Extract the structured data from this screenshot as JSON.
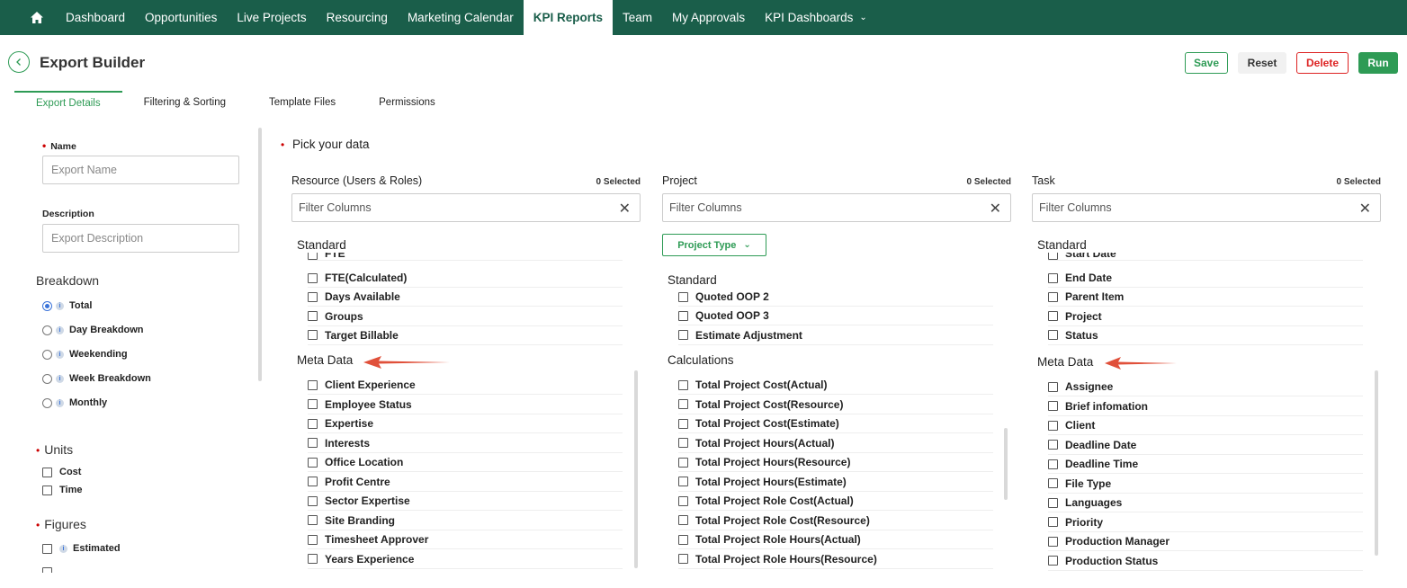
{
  "nav": {
    "items": [
      "Dashboard",
      "Opportunities",
      "Live Projects",
      "Resourcing",
      "Marketing Calendar",
      "KPI Reports",
      "Team",
      "My Approvals",
      "KPI Dashboards"
    ],
    "active": "KPI Reports",
    "chevron": "⌄"
  },
  "header": {
    "title": "Export Builder",
    "buttons": {
      "save": "Save",
      "reset": "Reset",
      "delete": "Delete",
      "run": "Run"
    }
  },
  "tabs": [
    "Export Details",
    "Filtering & Sorting",
    "Template Files",
    "Permissions"
  ],
  "active_tab": "Export Details",
  "left": {
    "name_label": "Name",
    "name_placeholder": "Export Name",
    "desc_label": "Description",
    "desc_placeholder": "Export Description",
    "breakdown_title": "Breakdown",
    "breakdown": [
      {
        "label": "Total",
        "selected": true
      },
      {
        "label": "Day Breakdown",
        "selected": false
      },
      {
        "label": "Weekending",
        "selected": false
      },
      {
        "label": "Week Breakdown",
        "selected": false
      },
      {
        "label": "Monthly",
        "selected": false
      }
    ],
    "units_title": "Units",
    "units": [
      "Cost",
      "Time"
    ],
    "figures_title": "Figures",
    "figures": [
      "Estimated"
    ],
    "info_glyph": "i"
  },
  "main": {
    "pick_title": "Pick your data",
    "columns": [
      {
        "title": "Resource (Users & Roles)",
        "count": "0 Selected",
        "filter_placeholder": "Filter Columns",
        "standard_label": "Standard",
        "standard_partial": "FTE",
        "standard_items": [
          "FTE(Calculated)",
          "Days Available",
          "Groups",
          "Target Billable"
        ],
        "second_label": "Meta Data",
        "second_items": [
          "Client Experience",
          "Employee Status",
          "Expertise",
          "Interests",
          "Office Location",
          "Profit Centre",
          "Sector Expertise",
          "Site Branding",
          "Timesheet Approver",
          "Years Experience"
        ]
      },
      {
        "title": "Project",
        "count": "0 Selected",
        "filter_placeholder": "Filter Columns",
        "type_button": "Project Type",
        "standard_label": "Standard",
        "standard_items": [
          "Quoted OOP 2",
          "Quoted OOP 3",
          "Estimate Adjustment"
        ],
        "second_label": "Calculations",
        "second_items": [
          "Total Project Cost(Actual)",
          "Total Project Cost(Resource)",
          "Total Project Cost(Estimate)",
          "Total Project Hours(Actual)",
          "Total Project Hours(Resource)",
          "Total Project Hours(Estimate)",
          "Total Project Role Cost(Actual)",
          "Total Project Role Cost(Resource)",
          "Total Project Role Hours(Actual)",
          "Total Project Role Hours(Resource)"
        ]
      },
      {
        "title": "Task",
        "count": "0 Selected",
        "filter_placeholder": "Filter Columns",
        "standard_label": "Standard",
        "standard_partial": "Start Date",
        "standard_items": [
          "End Date",
          "Parent Item",
          "Project",
          "Status"
        ],
        "second_label": "Meta Data",
        "second_items": [
          "Assignee",
          "Brief infomation",
          "Client",
          "Deadline Date",
          "Deadline Time",
          "File Type",
          "Languages",
          "Priority",
          "Production Manager",
          "Production Status"
        ]
      }
    ]
  },
  "colors": {
    "nav_bg": "#1a5e4a",
    "accent": "#2e9b55",
    "danger": "#dd2222",
    "arrow": "#e0503a"
  }
}
